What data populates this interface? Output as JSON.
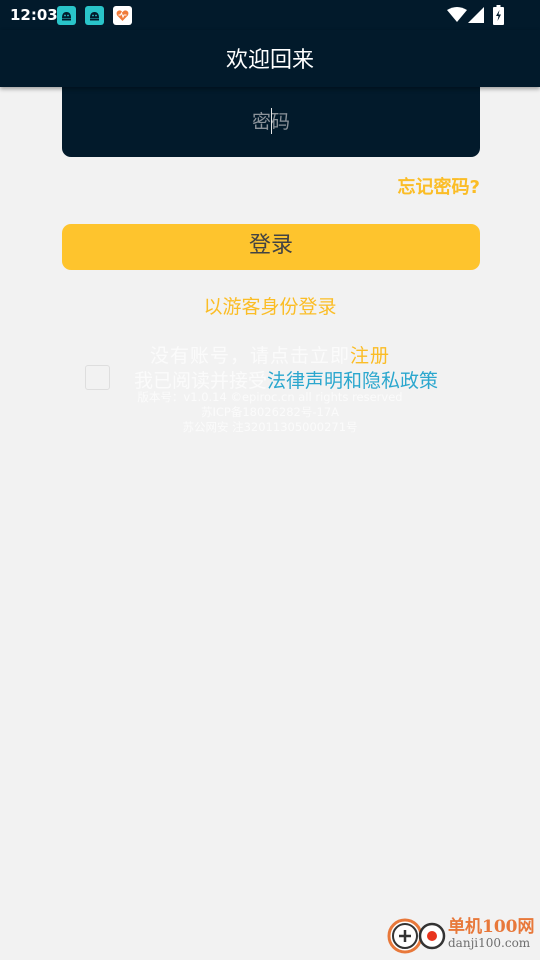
{
  "status_bar": {
    "time": "12:03",
    "notification_icons": [
      "android-robot-icon",
      "android-robot-icon",
      "heart-app-icon"
    ],
    "system_icons": [
      "wifi-icon",
      "signal-icon",
      "battery-icon"
    ]
  },
  "app_bar": {
    "title": "欢迎回来"
  },
  "form": {
    "password_placeholder": "密码",
    "password_value": "",
    "forgot_password": "忘记密码?",
    "login_button": "登录",
    "guest_login": "以游客身份登录"
  },
  "register": {
    "prompt": "没有账号，请点击立即",
    "link": "注册"
  },
  "agreement": {
    "checked": false,
    "prefix": "我已阅读并接受",
    "policy_link": "法律声明和隐私政策"
  },
  "footer": {
    "version_line": "版本号：v1.0.14  ©epiroc.cn all rights reserved",
    "icp_line": "苏ICP备18026282号-17A",
    "police_line": "苏公网安 注32011305000271号"
  },
  "watermark": {
    "name": "单机100网",
    "url": "danji100.com"
  },
  "colors": {
    "dark_navy": "#021a2b",
    "accent_yellow": "#fec42d",
    "link_yellow": "#fbbd26",
    "policy_blue": "#2ba7ce",
    "background": "#f2f2f2"
  }
}
